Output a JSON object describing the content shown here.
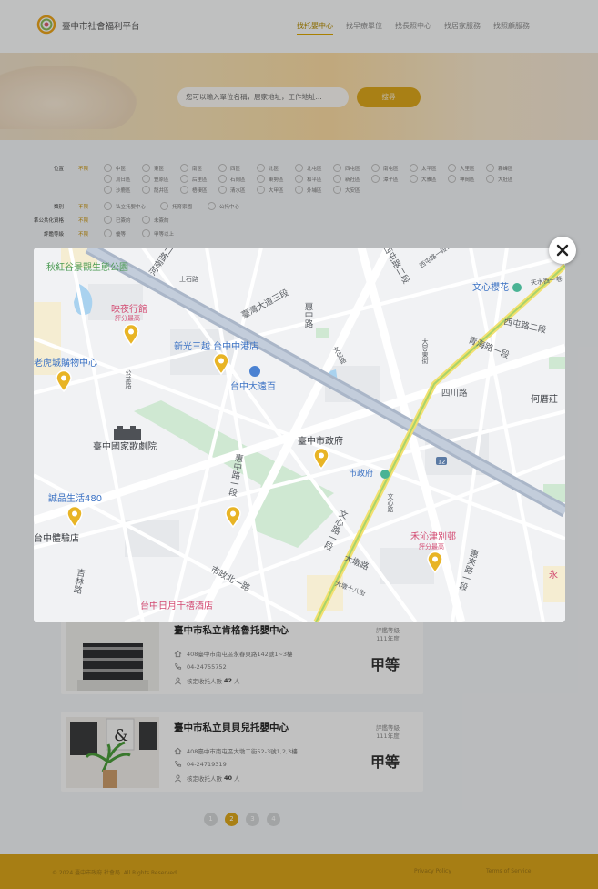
{
  "header": {
    "site_title": "臺中市社會福利平台",
    "nav": [
      {
        "label": "找托嬰中心",
        "active": true
      },
      {
        "label": "找早療單位",
        "active": false
      },
      {
        "label": "找長照中心",
        "active": false
      },
      {
        "label": "找居家服務",
        "active": false
      },
      {
        "label": "找照顧服務",
        "active": false
      }
    ]
  },
  "search": {
    "placeholder": "您可以輸入單位名稱，居家地址，工作地址...",
    "button_label": "搜尋"
  },
  "filters": {
    "location_label": "位置",
    "all_label": "不限",
    "districts": [
      "中區",
      "東區",
      "南區",
      "西區",
      "北區",
      "北屯區",
      "西屯區",
      "南屯區",
      "太平區",
      "大里區",
      "霧峰區",
      "烏日區",
      "豐原區",
      "后里區",
      "石岡區",
      "東勢區",
      "和平區",
      "新社區",
      "潭子區",
      "大雅區",
      "神岡區",
      "大肚區",
      "沙鹿區",
      "龍井區",
      "梧棲區",
      "清水區",
      "大甲區",
      "外埔區",
      "大安區"
    ],
    "type_label": "類別",
    "types": [
      "私立托嬰中心",
      "托育家園",
      "公托中心"
    ],
    "contract_label": "準公共化資格",
    "contracts": [
      "已簽約",
      "未簽約"
    ],
    "grade_label": "評鑑等級",
    "grades": [
      "優等",
      "甲等以上"
    ]
  },
  "listings": [
    {
      "name": "臺中市私立肯格魯托嬰中心",
      "address": "408臺中市南屯區永春東路142號1~3樓",
      "phone": "04-24755752",
      "capacity_prefix": "核定收托人數",
      "capacity": "42",
      "capacity_unit": "人",
      "grade_label": "評鑑等級",
      "grade_year": "111年度",
      "grade": "甲等"
    },
    {
      "name": "臺中市私立貝貝兒托嬰中心",
      "address": "408臺中市南屯區大墩二街52-3號1,2,3樓",
      "phone": "04-24719319",
      "capacity_prefix": "核定收托人數",
      "capacity": "40",
      "capacity_unit": "人",
      "grade_label": "評鑑等級",
      "grade_year": "111年度",
      "grade": "甲等"
    }
  ],
  "pagination": {
    "pages": [
      "1",
      "2",
      "3",
      "4"
    ],
    "current": "2"
  },
  "footer": {
    "copyright": "© 2024 臺中市政府 社會局. All Rights Reserved.",
    "privacy": "Privacy Policy",
    "terms": "Terms of Service"
  },
  "map": {
    "places": {
      "qiuhonggu": "秋紅谷景觀生態公園",
      "wenxin_sakura": "文心櫻花",
      "yingye": "映夜行館",
      "yingye_sub": "評分最高",
      "shin_kong": "新光三越 台中中港店",
      "taichung_dayuanbai": "台中大遠百",
      "tiger_city": "老虎城購物中心",
      "opera_house": "臺中國家歌劇院",
      "city_gov": "臺中市政府",
      "city_gov_stop": "市政府",
      "chengpin": "誠品生活480",
      "gym_store": "台中體驗店",
      "hewei": "禾沁津別邨",
      "hewei_sub": "評分最高",
      "riyue": "台中日月千禧酒店",
      "heqing": "何厝莊",
      "yong": "永"
    },
    "roads": {
      "taiwan_blvd": "臺灣大道三段",
      "xitun_2_upper": "西屯路二段",
      "xitun_2_right": "西屯路二段",
      "qinghai": "青海路一段",
      "sichuan": "四川路",
      "huizhong_upper": "惠中路",
      "huizhong_mid": "惠中路一段",
      "wenxin": "文心路一段",
      "shizheng_north1": "市政北一路",
      "dadun": "大墩路",
      "dadun_18": "大墩十八街",
      "henan": "河南路二段",
      "xitun_125": "西屯路一段125巷",
      "wenhua": "文化路",
      "gongyi": "公益路",
      "dakang": "大容東街",
      "huilai": "惠來路一段",
      "shangshi": "上石路",
      "jiwen": "吉林路",
      "wenxin_rd": "文心路",
      "road_no": "12",
      "tianmei": "天水西一巷"
    }
  }
}
